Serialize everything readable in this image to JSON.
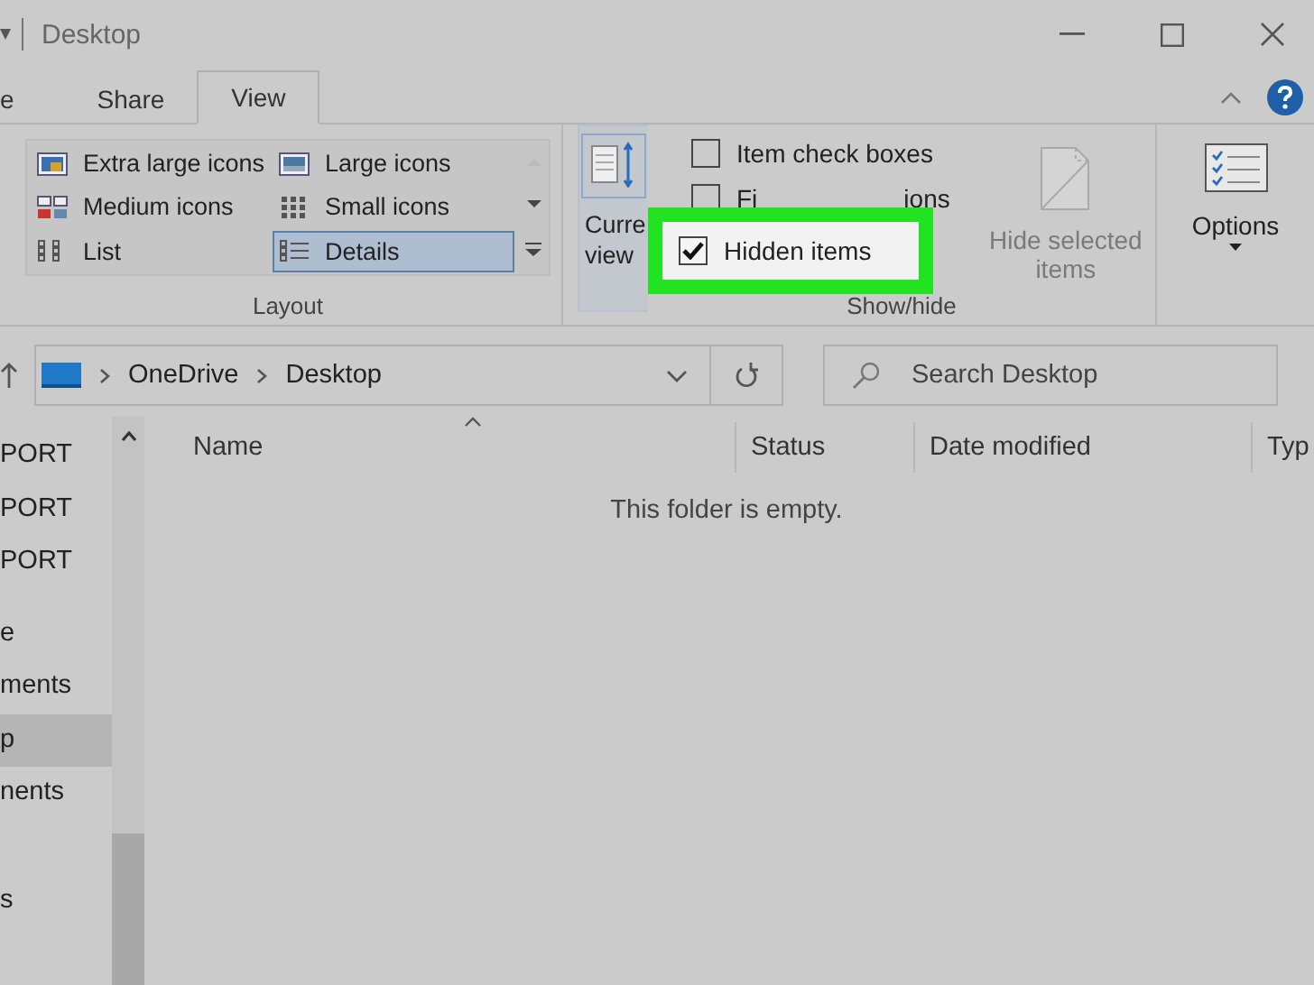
{
  "title_bar": {
    "title": "Desktop"
  },
  "tabs": [
    {
      "label": "e",
      "selected": false
    },
    {
      "label": "Share",
      "selected": false
    },
    {
      "label": "View",
      "selected": true
    }
  ],
  "layout_group": {
    "label": "Layout",
    "items": [
      {
        "label": "Extra large icons",
        "kind": "xl",
        "selected": false
      },
      {
        "label": "Large icons",
        "kind": "large",
        "selected": false
      },
      {
        "label": "Medium icons",
        "kind": "medium",
        "selected": false
      },
      {
        "label": "Small icons",
        "kind": "small",
        "selected": false
      },
      {
        "label": "List",
        "kind": "list",
        "selected": false
      },
      {
        "label": "Details",
        "kind": "details",
        "selected": true
      }
    ]
  },
  "current_view": {
    "lines": [
      "Curre",
      "view"
    ]
  },
  "show_hide": {
    "label": "Show/hide",
    "checkboxes": [
      {
        "parts": [
          "Item check boxes"
        ],
        "checked": false,
        "highlighted": false
      },
      {
        "parts": [
          "Fi",
          "ions"
        ],
        "checked": false,
        "highlighted": false
      },
      {
        "parts": [
          "Hidden items"
        ],
        "checked": true,
        "highlighted": true
      }
    ],
    "hide_selected": {
      "lines": [
        "Hide selected",
        "items"
      ]
    }
  },
  "options": {
    "label": "Options"
  },
  "address": {
    "crumbs": [
      "OneDrive",
      "Desktop"
    ]
  },
  "search": {
    "placeholder": "Search Desktop"
  },
  "nav": [
    {
      "label": "PORT",
      "selected": false
    },
    {
      "label": "PORT",
      "selected": false
    },
    {
      "label": "PORT",
      "selected": false
    },
    {
      "label": "e",
      "selected": false
    },
    {
      "label": "ments",
      "selected": false
    },
    {
      "label": "p",
      "selected": true
    },
    {
      "label": "nents",
      "selected": false
    },
    {
      "label": "s",
      "selected": false
    }
  ],
  "columns": [
    "Name",
    "Status",
    "Date modified",
    "Typ"
  ],
  "empty_message": "This folder is empty."
}
